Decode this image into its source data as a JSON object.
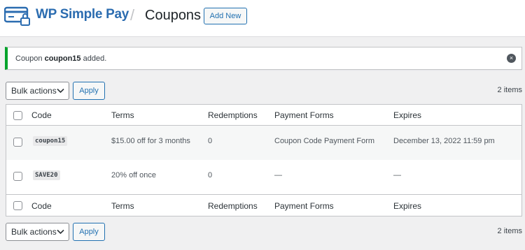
{
  "header": {
    "brand": "WP Simple Pay",
    "separator": "/",
    "page_title": "Coupons",
    "add_new_label": "Add New",
    "brand_color": "#2b6cb0"
  },
  "notice": {
    "prefix": "Coupon ",
    "coupon_name": "coupon15",
    "suffix": " added.",
    "dismiss_icon": "×",
    "accent": "#00a32a"
  },
  "tablenav_top": {
    "bulk_actions_label": "Bulk actions",
    "apply_label": "Apply",
    "items_count": "2 items"
  },
  "tablenav_bottom": {
    "bulk_actions_label": "Bulk actions",
    "apply_label": "Apply",
    "items_count": "2 items"
  },
  "table": {
    "columns": [
      "Code",
      "Terms",
      "Redemptions",
      "Payment Forms",
      "Expires"
    ],
    "rows": [
      {
        "code": "coupon15",
        "terms": "$15.00 off for 3 months",
        "redemptions": "0",
        "payment_forms": "Coupon Code Payment Form",
        "expires": "December 13, 2022 11:59 pm"
      },
      {
        "code": "SAVE20",
        "terms": "20% off once",
        "redemptions": "0",
        "payment_forms": "—",
        "expires": "—"
      }
    ]
  }
}
